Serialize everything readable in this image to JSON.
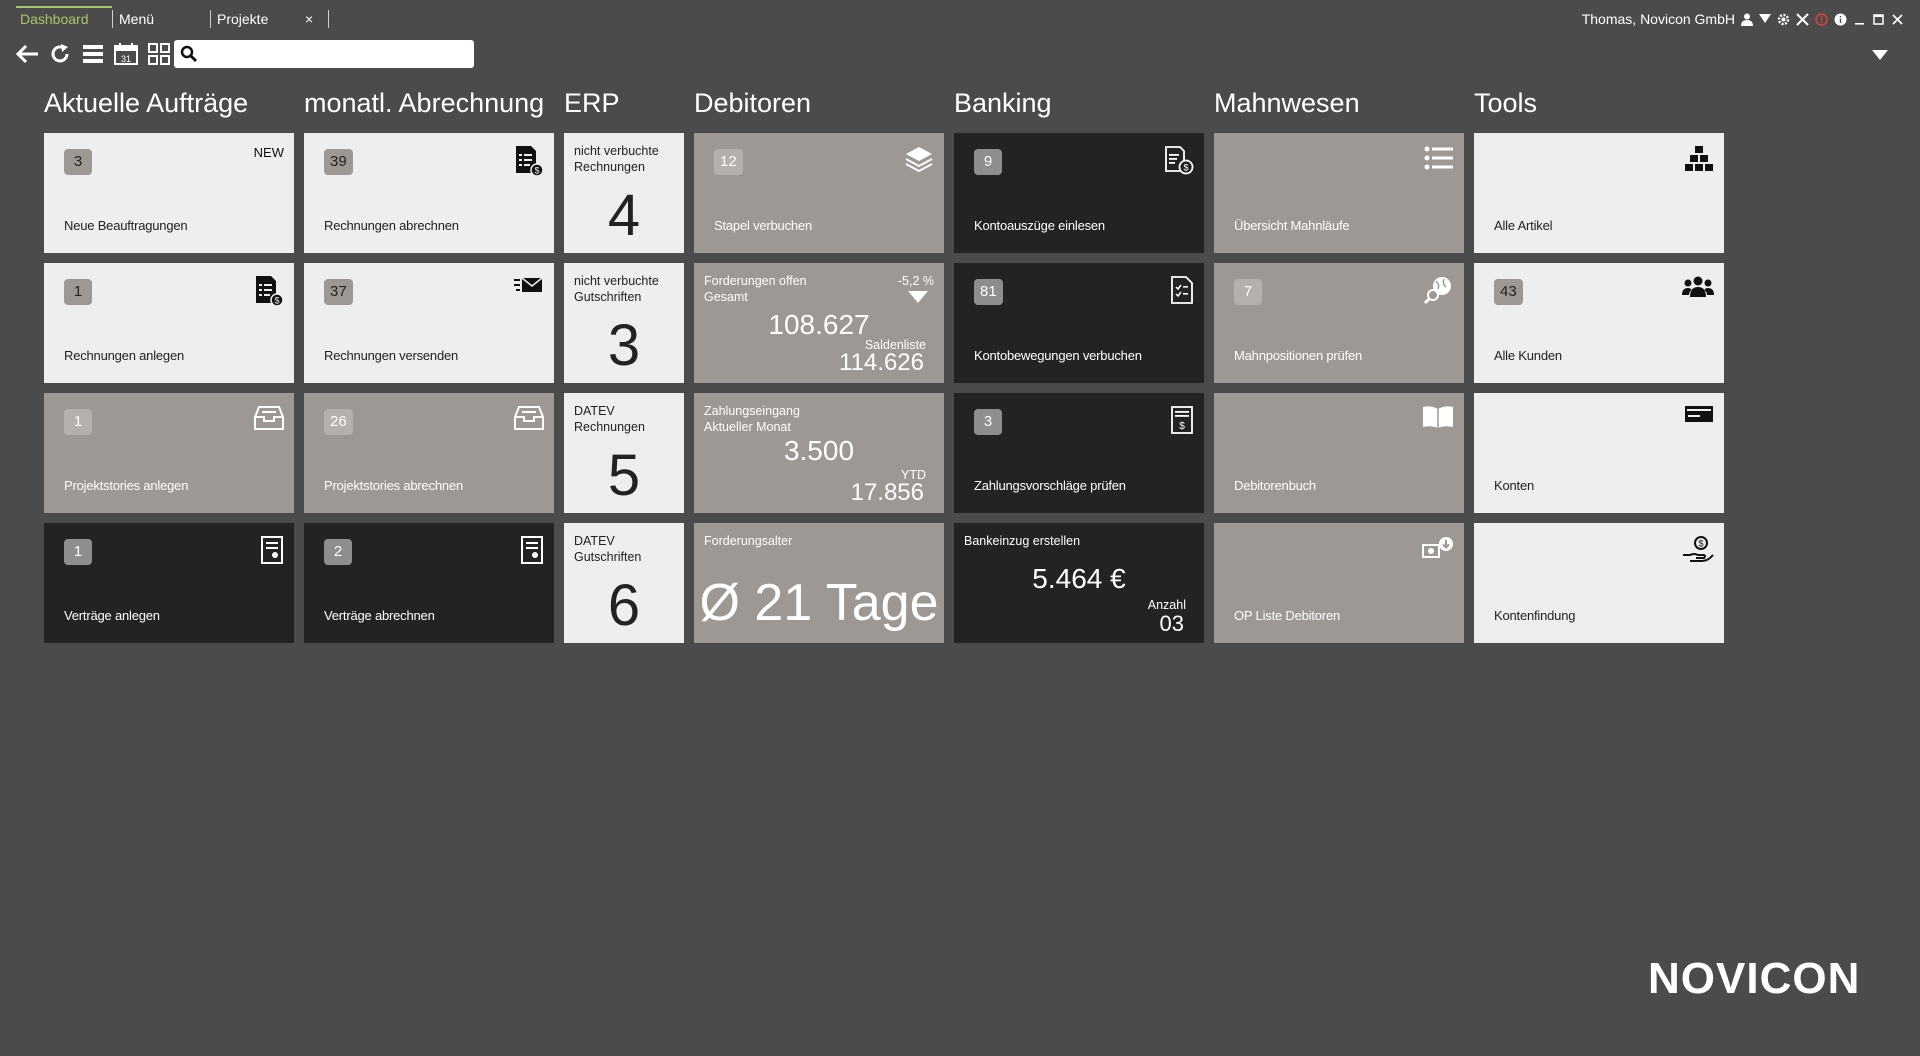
{
  "tabs": [
    {
      "label": "Dashboard"
    },
    {
      "label": "Menü"
    },
    {
      "label": "Projekte"
    }
  ],
  "tab_close": "×",
  "user": {
    "name": "Thomas, Novicon GmbH"
  },
  "search": {
    "placeholder": "",
    "value": ""
  },
  "colors": {
    "background": "#4b4b4b",
    "tile_light": "#eeeeee",
    "tile_grey": "#9d9893",
    "tile_dark": "#232323",
    "accent": "#a6c46a"
  },
  "columns": {
    "auftraege": "Aktuelle Aufträge",
    "abrechnung": "monatl. Abrechnung",
    "erp": "ERP",
    "debitoren": "Debitoren",
    "banking": "Banking",
    "mahnwesen": "Mahnwesen",
    "tools": "Tools"
  },
  "auftraege": [
    {
      "badge": "3",
      "label": "Neue Beauftragungen",
      "tag": "NEW"
    },
    {
      "badge": "1",
      "label": "Rechnungen anlegen",
      "icon": "invoice-dollar-icon"
    },
    {
      "badge": "1",
      "label": "Projektstories anlegen",
      "icon": "inbox-tray-icon"
    },
    {
      "badge": "1",
      "label": "Verträge anlegen",
      "icon": "contract-icon"
    }
  ],
  "abrechnung": [
    {
      "badge": "39",
      "label": "Rechnungen abrechnen",
      "icon": "invoice-dollar-icon"
    },
    {
      "badge": "37",
      "label": "Rechnungen versenden",
      "icon": "send-mail-icon"
    },
    {
      "badge": "26",
      "label": "Projektstories abrechnen",
      "icon": "inbox-tray-icon"
    },
    {
      "badge": "2",
      "label": "Verträge abrechnen",
      "icon": "contract-icon"
    }
  ],
  "erp": [
    {
      "line1": "nicht verbuchte",
      "line2": "Rechnungen",
      "value": "4"
    },
    {
      "line1": "nicht verbuchte",
      "line2": "Gutschriften",
      "value": "3"
    },
    {
      "line1": "DATEV",
      "line2": "Rechnungen",
      "value": "5"
    },
    {
      "line1": "DATEV",
      "line2": "Gutschriften",
      "value": "6"
    }
  ],
  "debitoren": {
    "stapel": {
      "badge": "12",
      "label": "Stapel verbuchen",
      "icon": "layers-icon"
    },
    "forderungen": {
      "line1": "Forderungen offen",
      "line2": "Gesamt",
      "change": "-5,2 %",
      "value": "108.627",
      "sub_label": "Saldenliste",
      "sub_value": "114.626"
    },
    "zahlung": {
      "line1": "Zahlungseingang",
      "line2": "Aktueller  Monat",
      "value": "3.500",
      "sub_label": "YTD",
      "sub_value": "17.856"
    },
    "alter": {
      "label": "Forderungsalter",
      "value": "Ø 21 Tage"
    }
  },
  "banking": {
    "kontoauszuege": {
      "badge": "9",
      "label": "Kontoauszüge einlesen",
      "icon": "statement-dollar-icon"
    },
    "kontobewegungen": {
      "badge": "81",
      "label": "Kontobewegungen verbuchen",
      "icon": "checklist-doc-icon"
    },
    "zahlungsvorschlaege": {
      "badge": "3",
      "label": "Zahlungsvorschläge prüfen",
      "icon": "payment-doc-icon"
    },
    "bankeinzug": {
      "label": "Bankeinzug erstellen",
      "value": "5.464 €",
      "sub_label": "Anzahl",
      "sub_value": "03"
    }
  },
  "mahnwesen": [
    {
      "badge": "",
      "label": "Übersicht Mahnläufe",
      "icon": "list-icon"
    },
    {
      "badge": "7",
      "label": "Mahnpositionen prüfen",
      "icon": "search-globe-icon"
    },
    {
      "badge": "",
      "label": "Debitorenbuch",
      "icon": "book-icon"
    },
    {
      "badge": "",
      "label": "OP Liste Debitoren",
      "icon": "cards-download-icon"
    }
  ],
  "tools": [
    {
      "badge": "",
      "label": "Alle Artikel",
      "icon": "boxes-icon"
    },
    {
      "badge": "43",
      "label": "Alle Kunden",
      "icon": "users-icon"
    },
    {
      "badge": "",
      "label": "Konten",
      "icon": "card-icon"
    },
    {
      "badge": "",
      "label": "Kontenfindung",
      "icon": "hand-coin-icon"
    }
  ],
  "logo": "NOVICON"
}
